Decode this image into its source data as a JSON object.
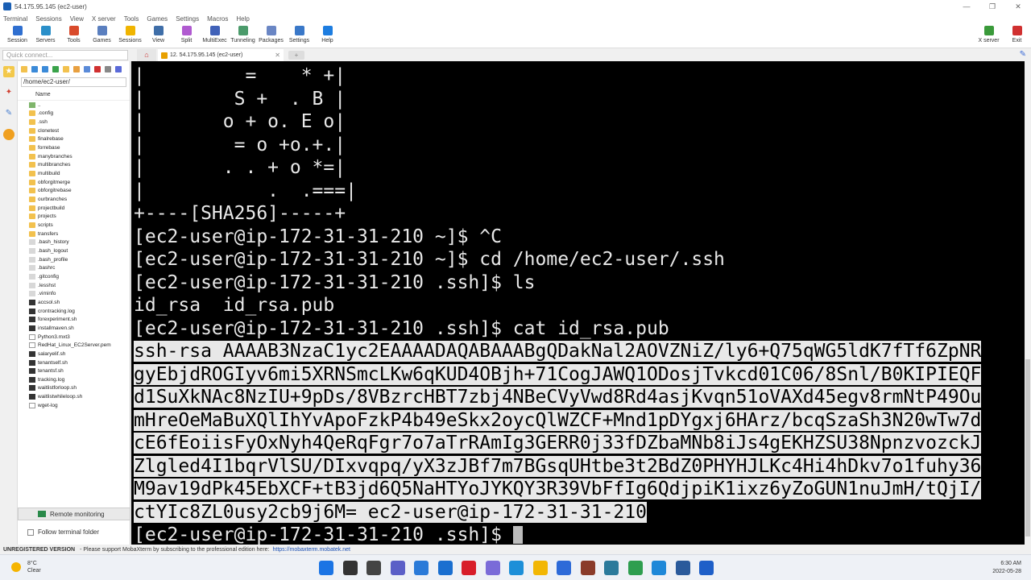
{
  "window": {
    "title": "54.175.95.145 (ec2-user)",
    "controls": [
      "—",
      "❐",
      "✕"
    ]
  },
  "menu": [
    "Terminal",
    "Sessions",
    "View",
    "X server",
    "Tools",
    "Games",
    "Settings",
    "Macros",
    "Help"
  ],
  "toolbar": {
    "left": [
      {
        "label": "Session",
        "color": "#2f6fd0"
      },
      {
        "label": "Servers",
        "color": "#2a8fc9"
      },
      {
        "label": "Tools",
        "color": "#d94a2b"
      },
      {
        "label": "Games",
        "color": "#5a7fbf"
      },
      {
        "label": "Sessions",
        "color": "#f0b400"
      },
      {
        "label": "View",
        "color": "#3f6ea8"
      },
      {
        "label": "Split",
        "color": "#b05ad0"
      },
      {
        "label": "MultiExec",
        "color": "#4061b8"
      },
      {
        "label": "Tunneling",
        "color": "#4b9b6b"
      },
      {
        "label": "Packages",
        "color": "#6a86c4"
      },
      {
        "label": "Settings",
        "color": "#3a78c8"
      },
      {
        "label": "Help",
        "color": "#1d7de0"
      }
    ],
    "right": [
      {
        "label": "X server",
        "color": "#3a9a3a"
      },
      {
        "label": "Exit",
        "color": "#d03030"
      }
    ]
  },
  "quick_connect": {
    "placeholder": "Quick connect..."
  },
  "tabs": {
    "home_icon": "home-icon",
    "active": "12. 54.175.95.145 (ec2-user)",
    "close": "✕"
  },
  "sidebar": {
    "path": "/home/ec2-user/",
    "column": "Name",
    "files": [
      {
        "name": "..",
        "type": "up"
      },
      {
        "name": ".config",
        "type": "folder"
      },
      {
        "name": ".ssh",
        "type": "folder"
      },
      {
        "name": "clonetest",
        "type": "folder"
      },
      {
        "name": "finalrebase",
        "type": "folder"
      },
      {
        "name": "forrebase",
        "type": "folder"
      },
      {
        "name": "manybranches",
        "type": "folder"
      },
      {
        "name": "multibranches",
        "type": "folder"
      },
      {
        "name": "multibuild",
        "type": "folder"
      },
      {
        "name": "obforgitmerge",
        "type": "folder"
      },
      {
        "name": "obforgitrebase",
        "type": "folder"
      },
      {
        "name": "ourbranches",
        "type": "folder"
      },
      {
        "name": "projectbuild",
        "type": "folder"
      },
      {
        "name": "projects",
        "type": "folder"
      },
      {
        "name": "scripts",
        "type": "folder"
      },
      {
        "name": "transfers",
        "type": "folder"
      },
      {
        "name": ".bash_history",
        "type": "hidden"
      },
      {
        "name": ".bash_logout",
        "type": "hidden"
      },
      {
        "name": ".bash_profile",
        "type": "hidden"
      },
      {
        "name": ".bashrc",
        "type": "hidden"
      },
      {
        "name": ".gitconfig",
        "type": "hidden"
      },
      {
        "name": ".lesshst",
        "type": "hidden"
      },
      {
        "name": ".viminfo",
        "type": "hidden"
      },
      {
        "name": "accsol.sh",
        "type": "exec"
      },
      {
        "name": "crontracking.log",
        "type": "exec"
      },
      {
        "name": "forexperiment.sh",
        "type": "exec"
      },
      {
        "name": "installmaven.sh",
        "type": "exec"
      },
      {
        "name": "Python3.mxt3",
        "type": "doc"
      },
      {
        "name": "RedHat_Linux_EC2Server.pem",
        "type": "doc"
      },
      {
        "name": "salaryelif.sh",
        "type": "exec"
      },
      {
        "name": "tenantself.sh",
        "type": "exec"
      },
      {
        "name": "tenantsf.sh",
        "type": "exec"
      },
      {
        "name": "tracking.log",
        "type": "exec"
      },
      {
        "name": "waitlistforloop.sh",
        "type": "exec"
      },
      {
        "name": "waitlistwhileloop.sh",
        "type": "exec"
      },
      {
        "name": "wget-log",
        "type": "doc"
      }
    ],
    "remote_monitoring": "Remote monitoring",
    "follow_folder": "Follow terminal folder"
  },
  "terminal": {
    "lines": [
      {
        "text": "|         =    * +|",
        "selected": false
      },
      {
        "text": "|        S +  . B |",
        "selected": false
      },
      {
        "text": "|       o + o. E o|",
        "selected": false
      },
      {
        "text": "|        = o +o.+.|",
        "selected": false
      },
      {
        "text": "|       . . + o *=|",
        "selected": false
      },
      {
        "text": "|           .  .===|",
        "selected": false
      },
      {
        "text": "+----[SHA256]-----+",
        "selected": false
      },
      {
        "text": "[ec2-user@ip-172-31-31-210 ~]$ ^C",
        "selected": false
      },
      {
        "text": "[ec2-user@ip-172-31-31-210 ~]$ cd /home/ec2-user/.ssh",
        "selected": false
      },
      {
        "text": "[ec2-user@ip-172-31-31-210 .ssh]$ ls",
        "selected": false
      },
      {
        "text": "id_rsa  id_rsa.pub",
        "selected": false
      },
      {
        "text": "[ec2-user@ip-172-31-31-210 .ssh]$ cat id_rsa.pub",
        "selected": false
      },
      {
        "text": "ssh-rsa AAAAB3NzaC1yc2EAAAADAQABAAABgQDakNal2AOVZNiZ/ly6+Q75qWG5ldK7fTf6ZpNR",
        "selected": true
      },
      {
        "text": "gyEbjdROGIyv6mi5XRNSmcLKw6qKUD4OBjh+71CogJAWQ1ODosjTvkcd01C06/8Snl/B0KIPIEQF",
        "selected": true
      },
      {
        "text": "d1SuXkNAc8NzIU+9pDs/8VBzrcHBT7zbj4NBeCVyVwd8Rd4asjKvqn51oVAXd45egv8rmNtP49Ou",
        "selected": true
      },
      {
        "text": "mHreOeMaBuXQlIhYvApoFzkP4b49eSkx2oycQlWZCF+Mnd1pDYgxj6HArz/bcqSzaSh3N20wTw7d",
        "selected": true
      },
      {
        "text": "cE6fEoiisFyOxNyh4QeRqFgr7o7aTrRAmIg3GERR0j33fDZbaMNb8iJs4gEKHZSU38NpnzvozckJ",
        "selected": true
      },
      {
        "text": "Zlgled4I1bqrVlSU/DIxvqpq/yX3zJBf7m7BGsqUHtbe3t2BdZ0PHYHJLKc4Hi4hDkv7o1fuhy36",
        "selected": true
      },
      {
        "text": "M9av19dPk45EbXCF+tB3jd6Q5NaHTYoJYKQY3R39VbFfIg6QdjpiK1ixz6yZoGUN1nuJmH/tQjI/",
        "selected": true
      },
      {
        "text": "ctYIc8ZL0usy2cb9j6M= ec2-user@ip-172-31-31-210",
        "selected": true
      },
      {
        "text": "[ec2-user@ip-172-31-31-210 .ssh]$ ",
        "selected": false,
        "cursor": true
      }
    ]
  },
  "status": {
    "unregistered": "UNREGISTERED VERSION",
    "message": "-  Please support MobaXterm by subscribing to the professional edition here:",
    "link": "https://mobaxterm.mobatek.net"
  },
  "taskbar": {
    "weather": {
      "temp": "8°C",
      "desc": "Clear"
    },
    "clock": {
      "time": "6:30 AM",
      "date": "2022-05-28"
    },
    "icons": [
      {
        "name": "windows-start-icon",
        "color": "#1b74e4"
      },
      {
        "name": "search-icon",
        "color": "#333333"
      },
      {
        "name": "file-explorer-icon",
        "color": "#444444"
      },
      {
        "name": "chat-icon",
        "color": "#5b5fc7"
      },
      {
        "name": "store-icon",
        "color": "#2a7ad8"
      },
      {
        "name": "mail-icon",
        "color": "#1a6fd0"
      },
      {
        "name": "opera-icon",
        "color": "#d81e2a"
      },
      {
        "name": "app-icon",
        "color": "#7a6bd8"
      },
      {
        "name": "edge-icon",
        "color": "#1d8fd8"
      },
      {
        "name": "folder-icon",
        "color": "#f2b705"
      },
      {
        "name": "zoom-icon",
        "color": "#2d6ad8"
      },
      {
        "name": "mobaxterm-icon",
        "color": "#8a3b2a"
      },
      {
        "name": "calculator-icon",
        "color": "#2b7a9b"
      },
      {
        "name": "chrome-icon",
        "color": "#2e9e4f"
      },
      {
        "name": "vscode-icon",
        "color": "#1e88d8"
      },
      {
        "name": "photos-icon",
        "color": "#2a5a9b"
      },
      {
        "name": "camera-icon",
        "color": "#1e5fc8"
      }
    ]
  }
}
